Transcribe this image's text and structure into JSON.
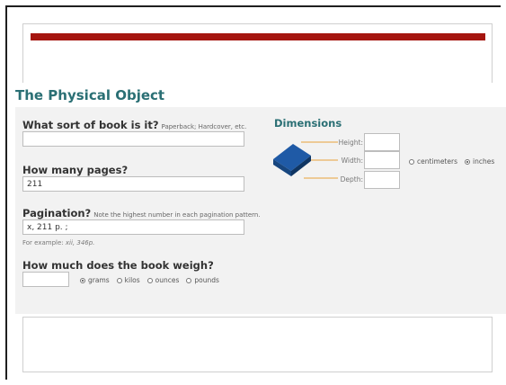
{
  "section": {
    "title": "The Physical Object"
  },
  "book_type": {
    "label": "What sort of book is it?",
    "hint": "Paperback; Hardcover, etc.",
    "value": ""
  },
  "pages": {
    "label": "How many pages?",
    "value": "211"
  },
  "pagination": {
    "label": "Pagination?",
    "hint": "Note the highest number in each pagination pattern.",
    "value": "x, 211 p. ;",
    "example_prefix": "For example: ",
    "example_value": "xii, 346p."
  },
  "weight": {
    "label": "How much does the book weigh?",
    "value": "",
    "units": [
      "grams",
      "kilos",
      "ounces",
      "pounds"
    ],
    "selected": "grams"
  },
  "dimensions": {
    "title": "Dimensions",
    "height_label": "Height:",
    "width_label": "Width:",
    "depth_label": "Depth:",
    "units": [
      "centimeters",
      "inches"
    ],
    "selected": "inches",
    "book_icon_color": "#1f5aa6",
    "leader_color": "#e8a33a"
  },
  "colors": {
    "accent_bar": "#a5150f",
    "heading": "#2a6f74",
    "panel": "#f2f2f2"
  }
}
